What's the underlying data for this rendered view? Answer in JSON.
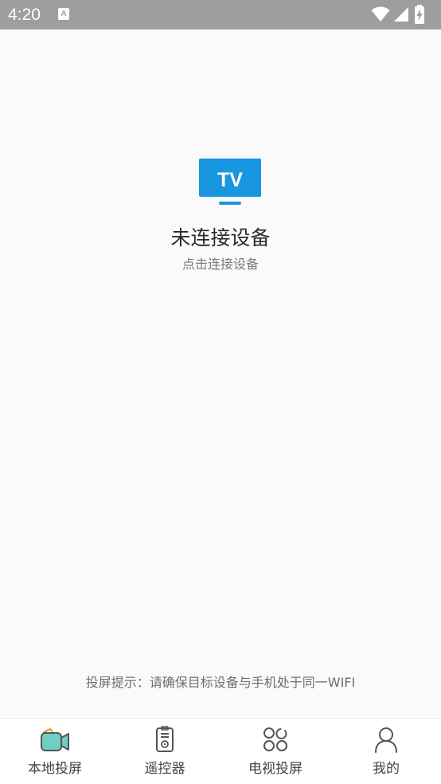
{
  "status_bar": {
    "time": "4:20",
    "notification_icon": "A",
    "icons": [
      "wifi-icon",
      "signal-icon",
      "battery-charging-icon"
    ],
    "background_color": "#9e9e9e"
  },
  "main": {
    "tv_icon_label": "TV",
    "title": "未连接设备",
    "subtitle": "点击连接设备",
    "hint": "投屏提示：请确保目标设备与手机处于同一WIFI",
    "accent_color": "#1896e0"
  },
  "bottom_nav": {
    "items": [
      {
        "label": "本地投屏",
        "icon": "video-camera-icon",
        "active": true
      },
      {
        "label": "遥控器",
        "icon": "remote-control-icon",
        "active": false
      },
      {
        "label": "电视投屏",
        "icon": "circles-grid-icon",
        "active": false
      },
      {
        "label": "我的",
        "icon": "person-icon",
        "active": false
      }
    ]
  }
}
